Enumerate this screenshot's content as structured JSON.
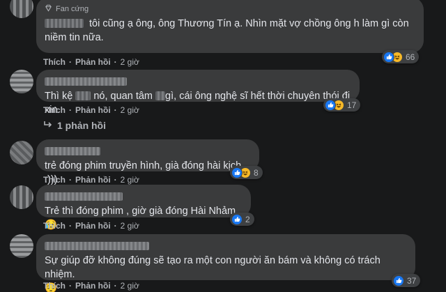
{
  "comments": [
    {
      "badge": "Fan cứng",
      "text": "tôi cũng ạ ông, ông Thương Tín ạ. Nhìn mặt vợ chồng ông h làm gì còn niềm tin nữa.",
      "like_label": "Thích",
      "reply_label": "Phản hồi",
      "time": "2 giờ",
      "reactions": [
        "like",
        "haha"
      ],
      "reaction_count": "66"
    },
    {
      "text_parts": [
        "Thì kệ",
        "nó, quan tâm",
        "gì, cái ông nghệ sĩ hết thời chuyên thói đi xin."
      ],
      "like_label": "Thích",
      "reply_label": "Phản hồi",
      "time": "2 giờ",
      "reactions": [
        "like",
        "haha"
      ],
      "reaction_count": "17",
      "replies_label": "1 phản hồi"
    },
    {
      "text": "trẻ đóng phim truyền hình, già đóng hài kịch :)))",
      "like_label": "Thích",
      "reply_label": "Phản hồi",
      "time": "2 giờ",
      "reactions": [
        "like",
        "haha"
      ],
      "reaction_count": "8"
    },
    {
      "text": "Trẻ thì đóng phim , giờ già đóng Hài Nhảm 😥",
      "like_label": "Thích",
      "reply_label": "Phản hồi",
      "time": "2 giờ",
      "reactions": [
        "like"
      ],
      "reaction_count": "2"
    },
    {
      "text": "Sự giúp đỡ không đúng sẽ tạo ra một con người ăn bám và không có trách nhiệm.",
      "emoji_line": "😔",
      "like_label": "Thích",
      "reply_label": "Phản hồi",
      "time": "2 giờ",
      "reactions": [
        "like"
      ],
      "reaction_count": "37"
    }
  ],
  "icons": {
    "badge": "diamond-icon",
    "replies": "reply-arrow-icon",
    "like": "thumbs-up-icon",
    "haha": "laughing-face-icon"
  },
  "colors": {
    "background": "#18191a",
    "bubble": "#3a3b3c",
    "text": "#e4e6eb",
    "secondary_text": "#b0b3b8",
    "like_blue": "#1877f2",
    "haha_yellow": "#f7b928"
  }
}
